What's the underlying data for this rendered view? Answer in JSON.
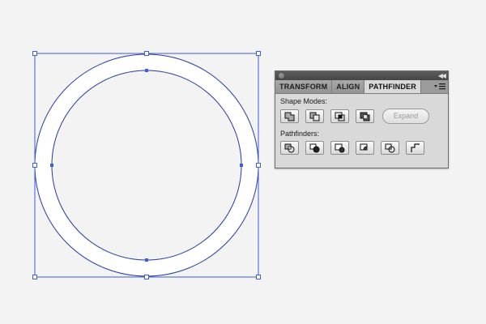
{
  "canvas": {
    "selection_color": "#3a5fd9",
    "ring_outline_color": "#1f2b7a",
    "ring_fill_color": "#ffffff"
  },
  "panel": {
    "tabs": [
      {
        "label": "TRANSFORM",
        "active": false
      },
      {
        "label": "ALIGN",
        "active": false
      },
      {
        "label": "PATHFINDER",
        "active": true
      }
    ],
    "shape_modes_label": "Shape Modes:",
    "pathfinders_label": "Pathfinders:",
    "expand_label": "Expand",
    "shape_mode_icons": [
      "unite-icon",
      "minus-front-icon",
      "intersect-icon",
      "exclude-icon"
    ],
    "pathfinder_icons": [
      "divide-icon",
      "trim-icon",
      "merge-icon",
      "crop-icon",
      "outline-icon",
      "minus-back-icon"
    ]
  }
}
